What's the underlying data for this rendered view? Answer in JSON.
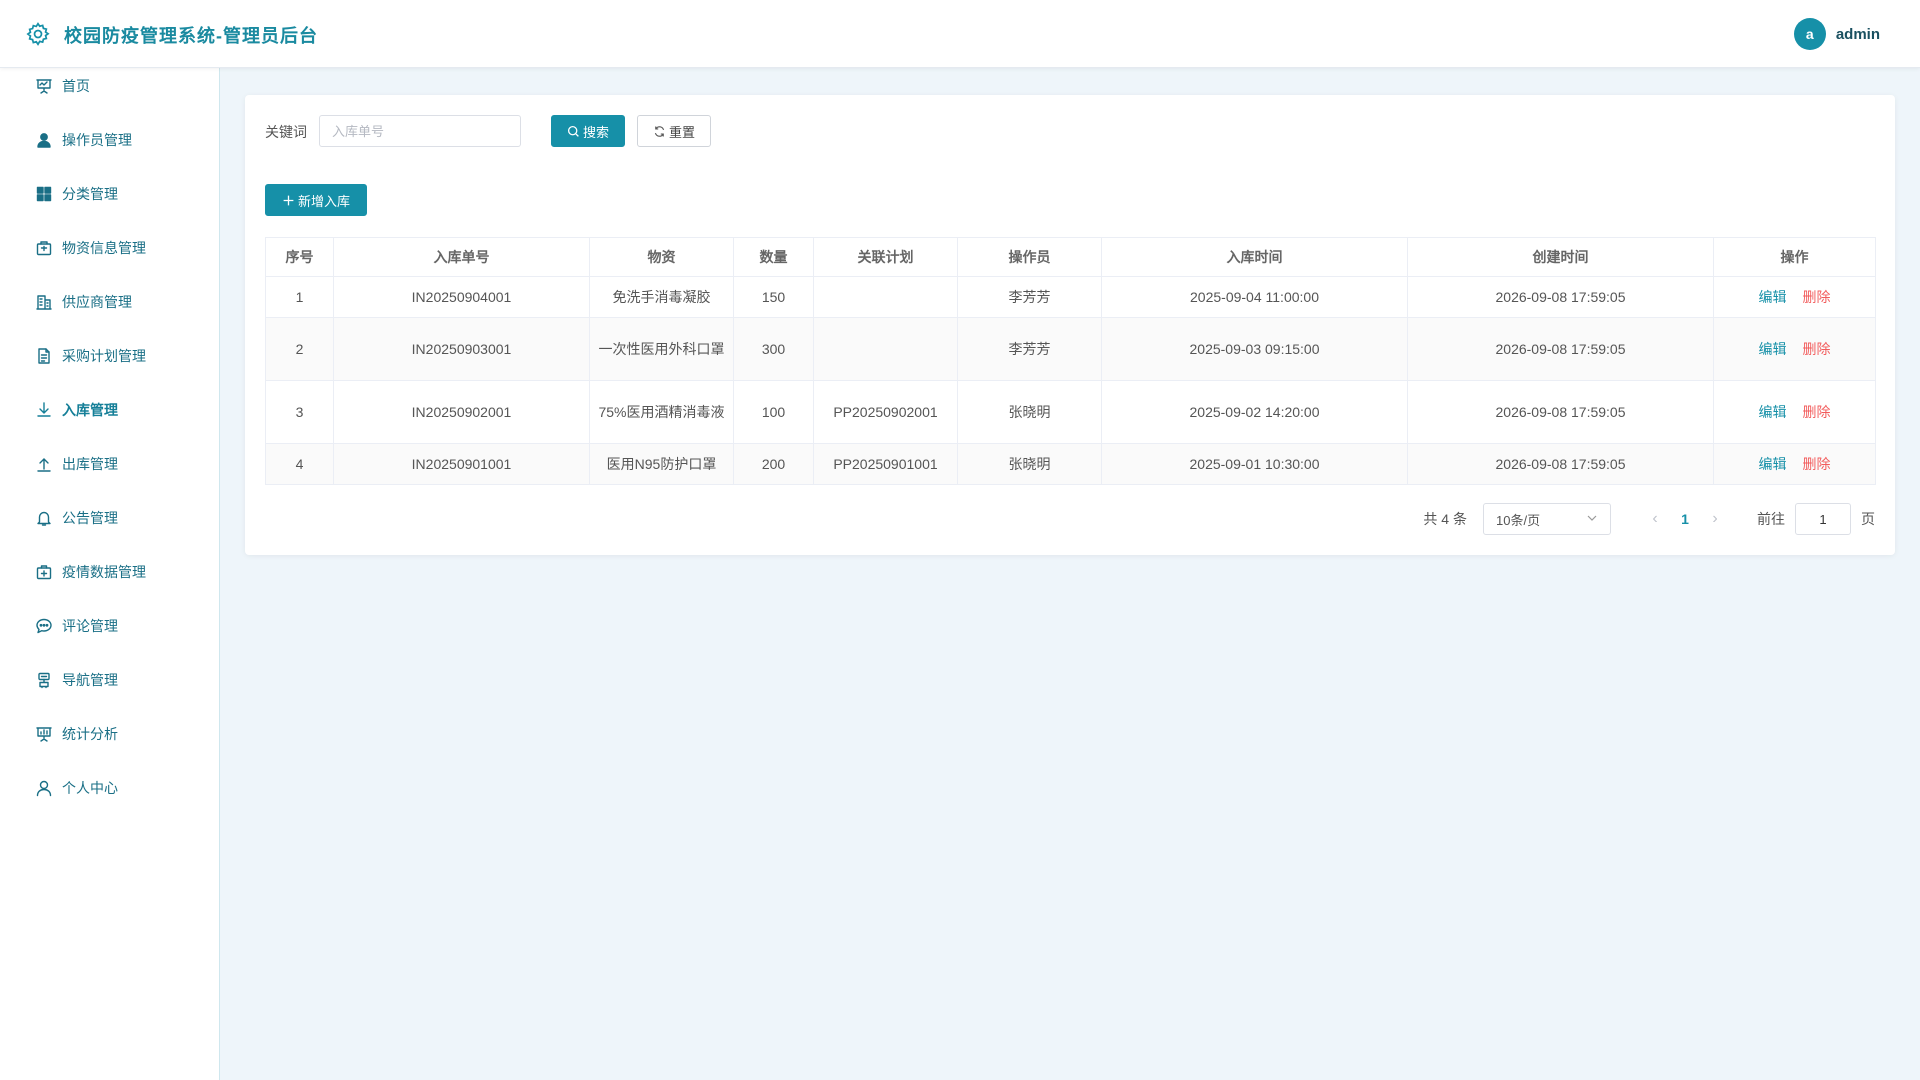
{
  "header": {
    "title": "校园防疫管理系统-管理员后台",
    "avatar_letter": "a",
    "username": "admin",
    "logo_icon": "gear-icon"
  },
  "colors": {
    "accent": "#1690a8",
    "danger": "#f25c5c",
    "page_bg": "#eef5fa"
  },
  "sidebar": {
    "items": [
      {
        "label": "首页",
        "icon": "presentation-icon",
        "active": false
      },
      {
        "label": "操作员管理",
        "icon": "user-icon",
        "active": false
      },
      {
        "label": "分类管理",
        "icon": "grid-icon",
        "active": false
      },
      {
        "label": "物资信息管理",
        "icon": "box-icon",
        "active": false
      },
      {
        "label": "供应商管理",
        "icon": "building-icon",
        "active": false
      },
      {
        "label": "采购计划管理",
        "icon": "document-icon",
        "active": false
      },
      {
        "label": "入库管理",
        "icon": "download-icon",
        "active": true
      },
      {
        "label": "出库管理",
        "icon": "upload-icon",
        "active": false
      },
      {
        "label": "公告管理",
        "icon": "bell-icon",
        "active": false
      },
      {
        "label": "疫情数据管理",
        "icon": "medical-box-icon",
        "active": false
      },
      {
        "label": "评论管理",
        "icon": "chat-icon",
        "active": false
      },
      {
        "label": "导航管理",
        "icon": "compass-icon",
        "active": false
      },
      {
        "label": "统计分析",
        "icon": "chart-board-icon",
        "active": false
      },
      {
        "label": "个人中心",
        "icon": "user-outline-icon",
        "active": false
      }
    ]
  },
  "search": {
    "label": "关键词",
    "placeholder": "入库单号",
    "value": "",
    "search_label": "搜索",
    "reset_label": "重置"
  },
  "toolbar": {
    "add_label": "新增入库"
  },
  "table": {
    "columns": [
      "序号",
      "入库单号",
      "物资",
      "数量",
      "关联计划",
      "操作员",
      "入库时间",
      "创建时间",
      "操作"
    ],
    "rows": [
      {
        "index": "1",
        "no": "IN20250904001",
        "material": "免洗手消毒凝胶",
        "qty": "150",
        "plan": "",
        "operator": "李芳芳",
        "in_time": "2025-09-04 11:00:00",
        "created": "2026-09-08 17:59:05"
      },
      {
        "index": "2",
        "no": "IN20250903001",
        "material": "一次性医用外科口罩",
        "qty": "300",
        "plan": "",
        "operator": "李芳芳",
        "in_time": "2025-09-03 09:15:00",
        "created": "2026-09-08 17:59:05"
      },
      {
        "index": "3",
        "no": "IN20250902001",
        "material": "75%医用酒精消毒液",
        "qty": "100",
        "plan": "PP20250902001",
        "operator": "张晓明",
        "in_time": "2025-09-02 14:20:00",
        "created": "2026-09-08 17:59:05"
      },
      {
        "index": "4",
        "no": "IN20250901001",
        "material": "医用N95防护口罩",
        "qty": "200",
        "plan": "PP20250901001",
        "operator": "张晓明",
        "in_time": "2025-09-01 10:30:00",
        "created": "2026-09-08 17:59:05"
      }
    ],
    "edit_label": "编辑",
    "delete_label": "删除"
  },
  "pagination": {
    "total_text": "共 4 条",
    "page_size": "10条/页",
    "current_page": "1",
    "goto_label": "前往",
    "goto_value": "1",
    "page_suffix": "页"
  }
}
